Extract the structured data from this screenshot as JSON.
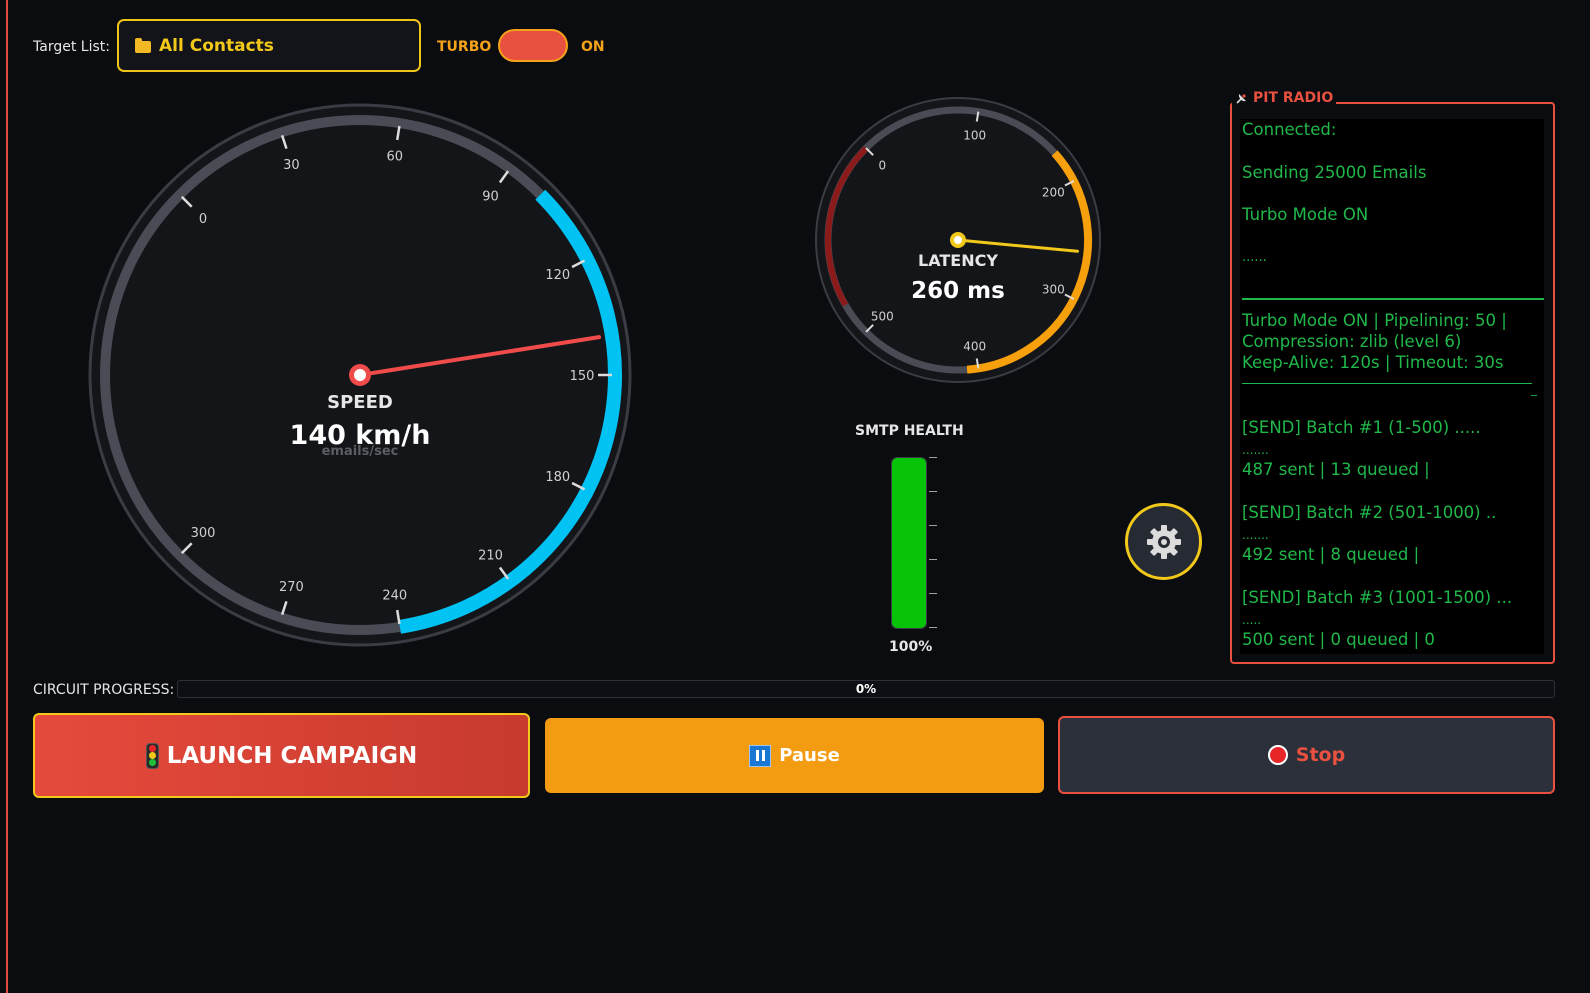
{
  "header": {
    "target_label": "Target List:",
    "target_value": "All Contacts",
    "turbo_label": "TURBO",
    "turbo_state": "ON"
  },
  "speed_gauge": {
    "title": "SPEED",
    "value_text": "140 km/h",
    "unit": "emails/sec",
    "value": 140,
    "min": 0,
    "max": 300,
    "ticks": [
      "0",
      "30",
      "60",
      "90",
      "120",
      "150",
      "180",
      "210",
      "240",
      "270",
      "300"
    ],
    "active_range": [
      100,
      240
    ],
    "colors": {
      "active": "#00c3f4",
      "needle": "#f04b4b",
      "track": "#4a4c55"
    }
  },
  "latency_gauge": {
    "title": "LATENCY",
    "value_text": "260 ms",
    "value": 260,
    "min": 0,
    "max": 500,
    "ticks": [
      "0",
      "100",
      "200",
      "300",
      "400",
      "500"
    ],
    "warn_range": [
      200,
      400
    ],
    "danger_range": [
      0,
      0
    ],
    "colors": {
      "warn": "#f5a00c",
      "danger": "#8b1a1a",
      "needle": "#f2c91a",
      "track": "#4a4c55"
    }
  },
  "smtp_health": {
    "title": "SMTP HEALTH",
    "value_text": "100%",
    "value": 100,
    "color": "#08c408"
  },
  "settings": {
    "icon": "gear-icon"
  },
  "pit_radio": {
    "title": "PIT RADIO",
    "icon": "satellite-icon",
    "lines": [
      "Connected:",
      "Sending  25000 Emails",
      "Turbo Mode ON",
      "......",
      "Turbo Mode ON  |  Pipelining: 50 |",
      "Compression: zlib (level 6)",
      "Keep-Alive: 120s | Timeout: 30s",
      "_",
      " [SEND] Batch #1 (1-500) .....",
      ".......",
      "487 sent | 13 queued |",
      " [SEND] Batch #2 (501-1000) ..",
      ".......",
      "492 sent | 8 queued |",
      " [SEND] Batch #3 (1001-1500) ...",
      ".....",
      "500 sent | 0 queued | 0"
    ]
  },
  "progress": {
    "label": "CIRCUIT PROGRESS:",
    "value_text": "0%",
    "value": 0
  },
  "buttons": {
    "launch": "LAUNCH CAMPAIGN",
    "pause": "Pause",
    "stop": "Stop"
  }
}
